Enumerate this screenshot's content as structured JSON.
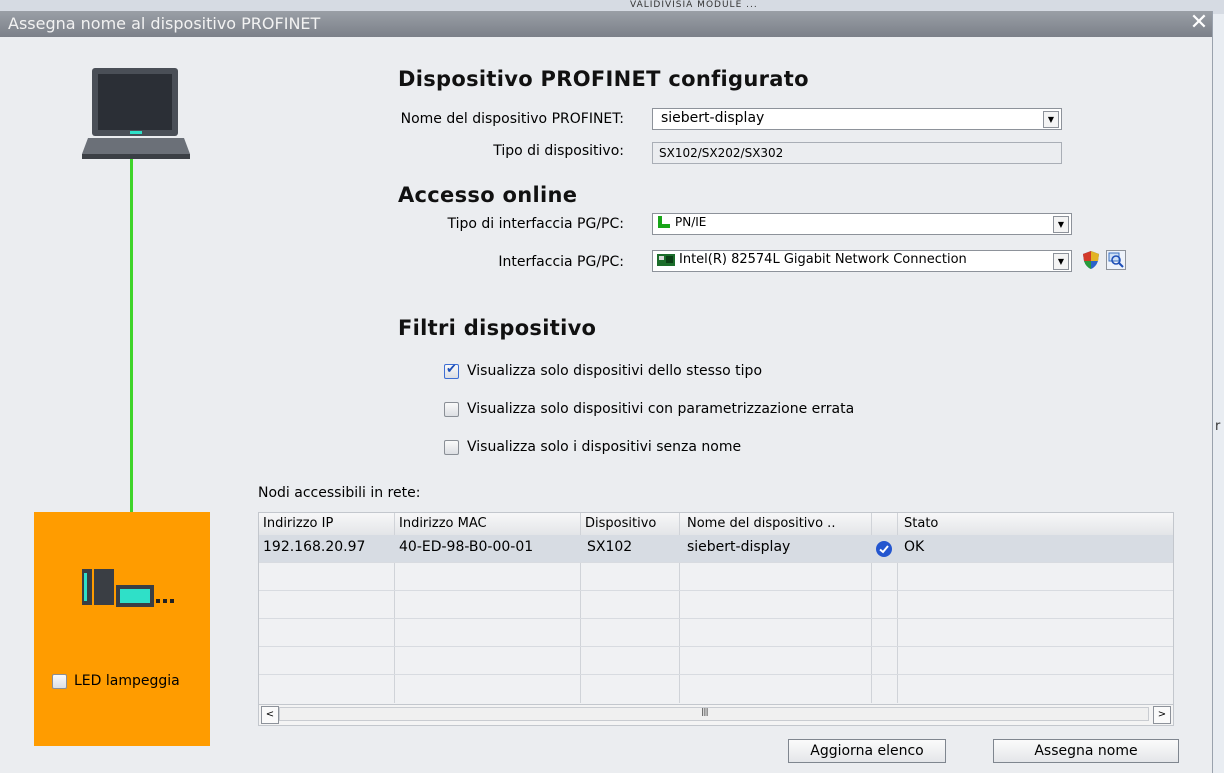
{
  "background_hint": "VALIDIVISIA MODULE  ...",
  "dialog": {
    "title": "Assegna nome al dispositivo PROFINET",
    "close_glyph": "✕"
  },
  "configured": {
    "heading": "Dispositivo PROFINET configurato",
    "name_label": "Nome del dispositivo PROFINET:",
    "name_value": "siebert-display",
    "type_label": "Tipo di dispositivo:",
    "type_value": "SX102/SX202/SX302"
  },
  "online": {
    "heading": "Accesso online",
    "iface_type_label": "Tipo di interfaccia PG/PC:",
    "iface_type_value": "PN/IE",
    "iface_label": "Interfaccia PG/PC:",
    "iface_value": "Intel(R) 82574L Gigabit Network Connection"
  },
  "filters": {
    "heading": "Filtri dispositivo",
    "items": [
      {
        "label": "Visualizza solo dispositivi dello stesso tipo",
        "checked": true
      },
      {
        "label": "Visualizza solo dispositivi con parametrizzazione errata",
        "checked": false
      },
      {
        "label": "Visualizza solo i dispositivi senza nome",
        "checked": false
      }
    ]
  },
  "nodes": {
    "label": "Nodi accessibili in rete:",
    "columns": [
      "Indirizzo IP",
      "Indirizzo MAC",
      "Dispositivo",
      "Nome del dispositivo ..",
      "",
      "Stato"
    ],
    "rows": [
      {
        "ip": "192.168.20.97",
        "mac": "40-ED-98-B0-00-01",
        "device": "SX102",
        "name": "siebert-display",
        "status_icon": "check-circle-icon",
        "status": "OK"
      }
    ],
    "scroll_thumb_glyph": "III"
  },
  "left_panel": {
    "led_label": "LED lampeggia",
    "led_checked": false
  },
  "buttons": {
    "refresh": "Aggiorna elenco",
    "assign": "Assegna nome"
  },
  "colors": {
    "accent_orange": "#ff9c00",
    "link_green": "#3fd42a",
    "check_blue": "#1e4fb8"
  }
}
